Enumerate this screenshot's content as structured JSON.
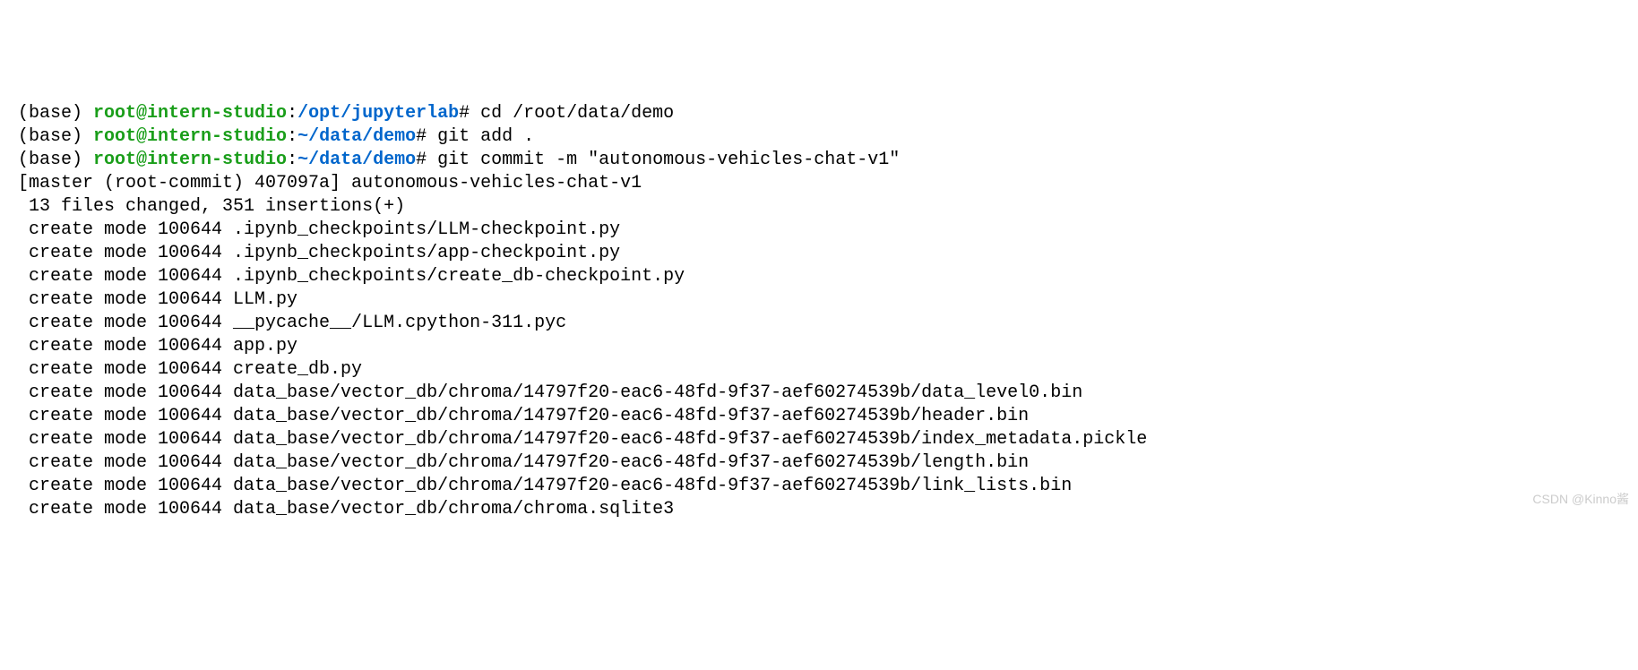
{
  "prompts": [
    {
      "env": "(base) ",
      "userhost": "root@intern-studio",
      "colon": ":",
      "path": "/opt/jupyterlab",
      "sigil": "# ",
      "command": "cd /root/data/demo"
    },
    {
      "env": "(base) ",
      "userhost": "root@intern-studio",
      "colon": ":",
      "path": "~/data/demo",
      "sigil": "# ",
      "command": "git add ."
    },
    {
      "env": "(base) ",
      "userhost": "root@intern-studio",
      "colon": ":",
      "path": "~/data/demo",
      "sigil": "# ",
      "command": "git commit -m \"autonomous-vehicles-chat-v1\""
    }
  ],
  "output_lines": [
    "[master (root-commit) 407097a] autonomous-vehicles-chat-v1",
    " 13 files changed, 351 insertions(+)",
    " create mode 100644 .ipynb_checkpoints/LLM-checkpoint.py",
    " create mode 100644 .ipynb_checkpoints/app-checkpoint.py",
    " create mode 100644 .ipynb_checkpoints/create_db-checkpoint.py",
    " create mode 100644 LLM.py",
    " create mode 100644 __pycache__/LLM.cpython-311.pyc",
    " create mode 100644 app.py",
    " create mode 100644 create_db.py",
    " create mode 100644 data_base/vector_db/chroma/14797f20-eac6-48fd-9f37-aef60274539b/data_level0.bin",
    " create mode 100644 data_base/vector_db/chroma/14797f20-eac6-48fd-9f37-aef60274539b/header.bin",
    " create mode 100644 data_base/vector_db/chroma/14797f20-eac6-48fd-9f37-aef60274539b/index_metadata.pickle",
    " create mode 100644 data_base/vector_db/chroma/14797f20-eac6-48fd-9f37-aef60274539b/length.bin",
    " create mode 100644 data_base/vector_db/chroma/14797f20-eac6-48fd-9f37-aef60274539b/link_lists.bin",
    " create mode 100644 data_base/vector_db/chroma/chroma.sqlite3"
  ],
  "watermark": "CSDN @Kinno酱"
}
